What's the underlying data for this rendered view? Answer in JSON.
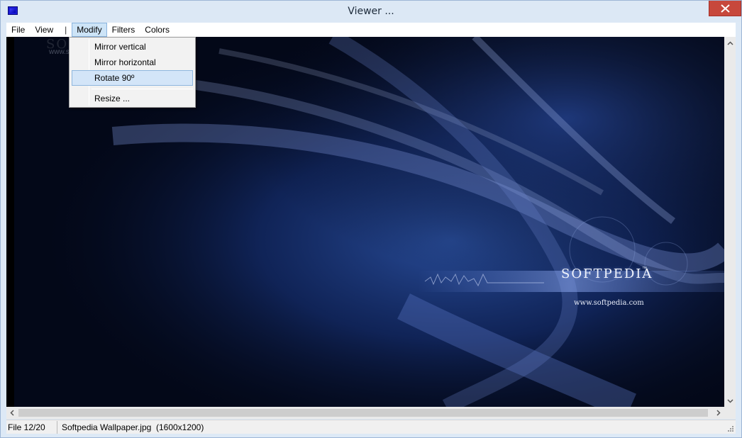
{
  "window": {
    "title": "Viewer ..."
  },
  "menu": {
    "file": "File",
    "view": "View",
    "separator": "|",
    "modify": "Modify",
    "filters": "Filters",
    "colors": "Colors"
  },
  "modify_menu": {
    "mirror_vertical": "Mirror vertical",
    "mirror_horizontal": "Mirror horizontal",
    "rotate": "Rotate 90º",
    "resize": "Resize ..."
  },
  "image": {
    "watermark": "SOFTPEDIA",
    "watermark_url": "www.softpedia.com",
    "brand": "SOFTPEDIA",
    "brand_tm": "™",
    "brand_url": "www.softpedia.com"
  },
  "status": {
    "file_index": "File 12/20",
    "file_info": "Softpedia Wallpaper.jpg  (1600x1200)"
  },
  "colors": {
    "menu_highlight": "#cde4f7",
    "close_button": "#c7483c",
    "image_background": "#020512"
  }
}
